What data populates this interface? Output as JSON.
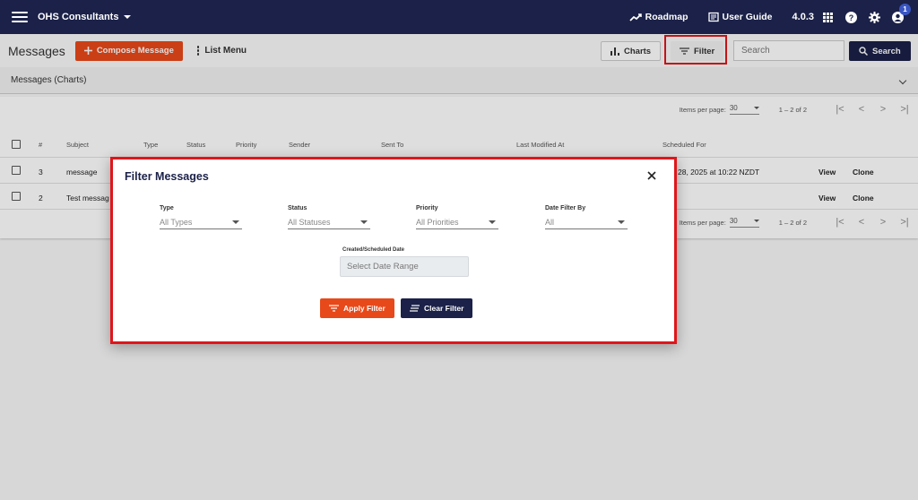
{
  "topnav": {
    "org_name": "OHS Consultants",
    "roadmap_label": "Roadmap",
    "user_guide_label": "User Guide",
    "version": "4.0.3",
    "notification_count": "1"
  },
  "toolbar": {
    "title": "Messages",
    "compose_label": "Compose Message",
    "list_menu_label": "List Menu",
    "charts_label": "Charts",
    "filter_label": "Filter",
    "search_placeholder": "Search",
    "search_label": "Search"
  },
  "charts_panel": {
    "label": "Messages (Charts)"
  },
  "paginator": {
    "items_per_page_label": "Items per page:",
    "items_per_page": "30",
    "range": "1 – 2 of 2"
  },
  "table": {
    "columns": {
      "index": "#",
      "subject": "Subject",
      "type": "Type",
      "status": "Status",
      "priority": "Priority",
      "sender": "Sender",
      "sent_to": "Sent To",
      "last_modified": "Last Modified At",
      "scheduled_for": "Scheduled For"
    },
    "rows": [
      {
        "index": "3",
        "subject": "message",
        "scheduled_for": "28, 2025 at 10:22 NZDT",
        "view": "View",
        "clone": "Clone"
      },
      {
        "index": "2",
        "subject": "Test messag",
        "scheduled_for": "",
        "view": "View",
        "clone": "Clone"
      }
    ]
  },
  "dialog": {
    "title": "Filter Messages",
    "type_label": "Type",
    "type_value": "All Types",
    "status_label": "Status",
    "status_value": "All Statuses",
    "priority_label": "Priority",
    "priority_value": "All Priorities",
    "date_filter_label": "Date Filter By",
    "date_filter_value": "All",
    "date_range_label": "Created/Scheduled Date",
    "date_range_placeholder": "Select Date Range",
    "apply_label": "Apply Filter",
    "clear_label": "Clear Filter"
  },
  "colors": {
    "nav_bg": "#1b2148",
    "accent_orange": "#e8491a",
    "highlight_red": "#e0161b"
  }
}
